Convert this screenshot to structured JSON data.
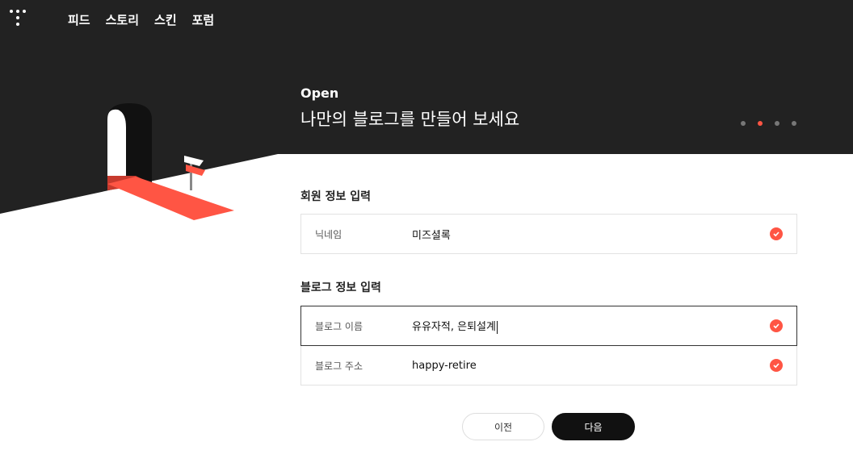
{
  "nav": {
    "items": [
      "피드",
      "스토리",
      "스킨",
      "포럼"
    ]
  },
  "hero": {
    "label": "Open",
    "title": "나만의 블로그를 만들어 보세요",
    "steps_total": 4,
    "steps_active_index": 1
  },
  "member_section": {
    "title": "회원 정보 입력",
    "nickname_label": "닉네임",
    "nickname_value": "미즈셜록"
  },
  "blog_section": {
    "title": "블로그 정보 입력",
    "name_label": "블로그 이름",
    "name_value": "유유자적, 은퇴설계",
    "address_label": "블로그 주소",
    "address_value": "happy-retire"
  },
  "buttons": {
    "prev": "이전",
    "next": "다음"
  },
  "colors": {
    "dark": "#222222",
    "accent": "#ff5544"
  }
}
